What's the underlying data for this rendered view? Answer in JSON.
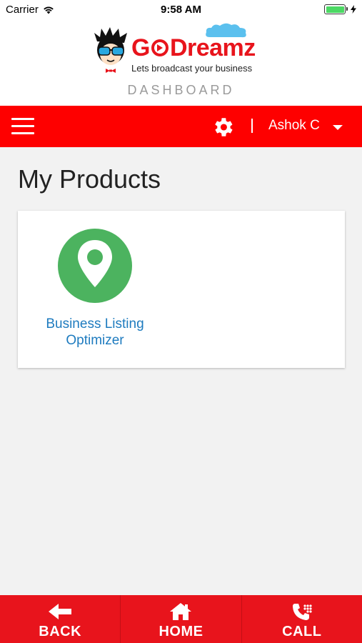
{
  "status_bar": {
    "carrier": "Carrier",
    "time": "9:58 AM"
  },
  "header": {
    "logo_go": "G",
    "logo_dreamz": "Dreamz",
    "tagline": "Lets broadcast your business",
    "section_title": "DASHBOARD"
  },
  "navbar": {
    "user_name": "Ashok C",
    "colors": {
      "background": "#fe0000"
    }
  },
  "main": {
    "title": "My Products",
    "products": [
      {
        "label": "Business Listing Optimizer",
        "icon": "map-pin-icon",
        "color": "#4cb35f"
      }
    ]
  },
  "bottom_bar": {
    "back_label": "BACK",
    "home_label": "HOME",
    "call_label": "CALL"
  }
}
